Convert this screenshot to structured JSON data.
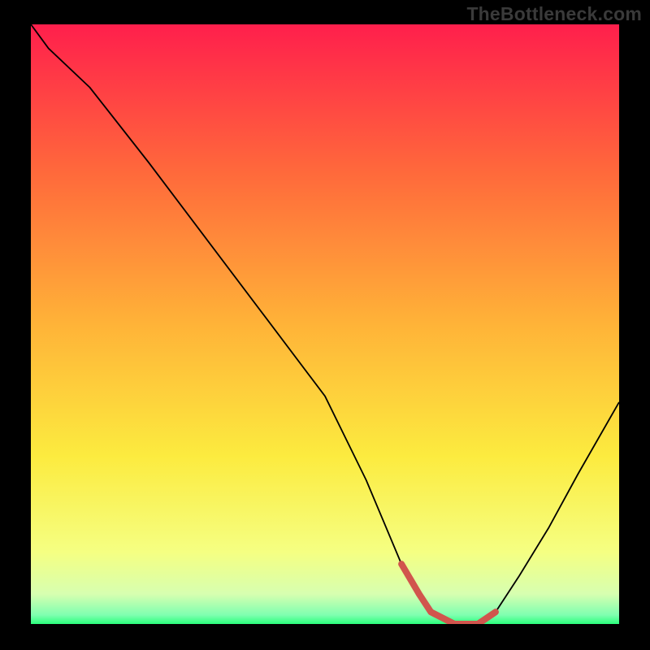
{
  "watermark": "TheBottleneck.com",
  "chart_data": {
    "type": "line",
    "title": "",
    "xlabel": "",
    "ylabel": "",
    "xlim": [
      0,
      100
    ],
    "ylim": [
      0,
      100
    ],
    "x": [
      0,
      3,
      10,
      20,
      30,
      40,
      50,
      57,
      60,
      63,
      66,
      68,
      72,
      76,
      79,
      83,
      88,
      93,
      100
    ],
    "values": [
      100,
      96,
      89.5,
      77,
      64,
      51,
      38,
      24,
      17,
      10,
      5,
      2,
      0,
      0,
      2,
      8,
      16,
      25,
      37
    ],
    "highlight": {
      "color": "#d1554d",
      "x": [
        63,
        66,
        68,
        72,
        76,
        79
      ],
      "values": [
        10,
        5,
        2,
        0,
        0,
        2
      ]
    },
    "gradient_stops": [
      {
        "offset": 0,
        "color": "#ff1f4c"
      },
      {
        "offset": 0.25,
        "color": "#ff6a3b"
      },
      {
        "offset": 0.5,
        "color": "#ffb338"
      },
      {
        "offset": 0.72,
        "color": "#fceb3f"
      },
      {
        "offset": 0.88,
        "color": "#f5ff82"
      },
      {
        "offset": 0.95,
        "color": "#d7ffb0"
      },
      {
        "offset": 0.985,
        "color": "#7fffb0"
      },
      {
        "offset": 1.0,
        "color": "#2bff7c"
      }
    ]
  }
}
